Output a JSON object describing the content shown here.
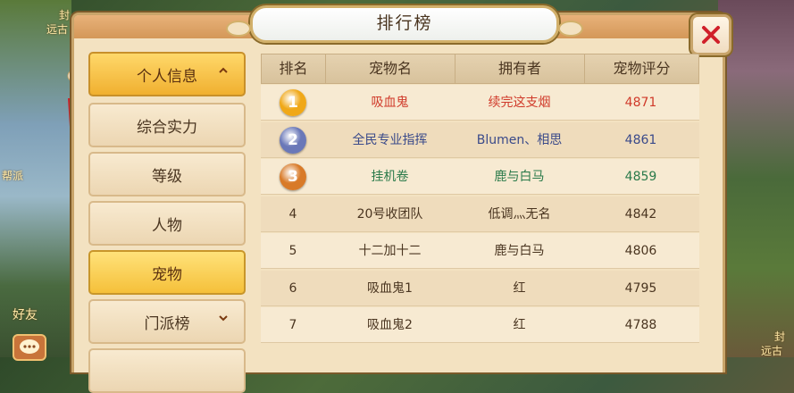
{
  "background": {
    "left_labels": [
      "封",
      "远古",
      "帮派",
      "好友"
    ],
    "right_labels": [
      "封",
      "远古"
    ]
  },
  "title": "排行榜",
  "sidebar": {
    "header": "个人信息",
    "items": [
      "综合实力",
      "等级",
      "人物",
      "宠物"
    ],
    "active": "宠物",
    "section": "门派榜"
  },
  "table": {
    "columns": [
      "排名",
      "宠物名",
      "拥有者",
      "宠物评分"
    ],
    "rows": [
      {
        "rank": "1",
        "pet": "吸血鬼",
        "owner": "续完这支烟",
        "score": "4871"
      },
      {
        "rank": "2",
        "pet": "全民专业指挥",
        "owner": "Blumen、相思",
        "score": "4861"
      },
      {
        "rank": "3",
        "pet": "挂机卷",
        "owner": "鹿与白马",
        "score": "4859"
      },
      {
        "rank": "4",
        "pet": "20号收团队",
        "owner": "低调灬无名",
        "score": "4842"
      },
      {
        "rank": "5",
        "pet": "十二加十二",
        "owner": "鹿与白马",
        "score": "4806"
      },
      {
        "rank": "6",
        "pet": "吸血鬼1",
        "owner": "红",
        "score": "4795"
      },
      {
        "rank": "7",
        "pet": "吸血鬼2",
        "owner": "红",
        "score": "4788"
      }
    ]
  },
  "colors": {
    "rank1": "#d03a2a",
    "rank2": "#3a4a8a",
    "rank3": "#2a7a4a",
    "normal": "#4a3520",
    "medal_gold": "#f0a818",
    "medal_silver": "#6a78b8",
    "medal_bronze": "#d87a28"
  }
}
